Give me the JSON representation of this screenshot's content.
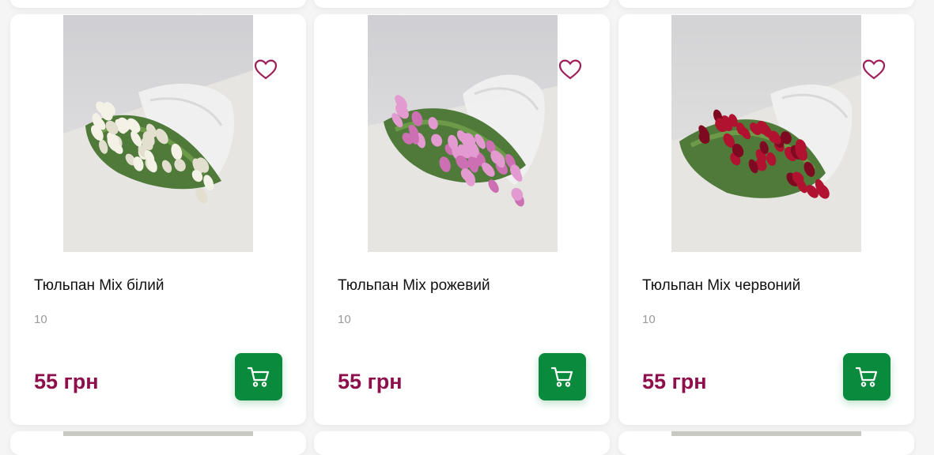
{
  "products": [
    {
      "title": "Тюльпан Mix білий",
      "quantity": "10",
      "price": "55 грн",
      "flower_color": "#f4f1e6",
      "flower_shade": "#e3dfcf"
    },
    {
      "title": "Тюльпан Mix рожевий",
      "quantity": "10",
      "price": "55 грн",
      "flower_color": "#e39ad0",
      "flower_shade": "#cc6fb3"
    },
    {
      "title": "Тюльпан Mix червоний",
      "quantity": "10",
      "price": "55 грн",
      "flower_color": "#b0122f",
      "flower_shade": "#7e0a22"
    }
  ],
  "icons": {
    "favorite": "heart-outline-icon",
    "cart": "shopping-cart-icon"
  },
  "colors": {
    "price": "#8e0f4c",
    "heart": "#9c1e5a",
    "cart_button": "#0a8a3c"
  }
}
